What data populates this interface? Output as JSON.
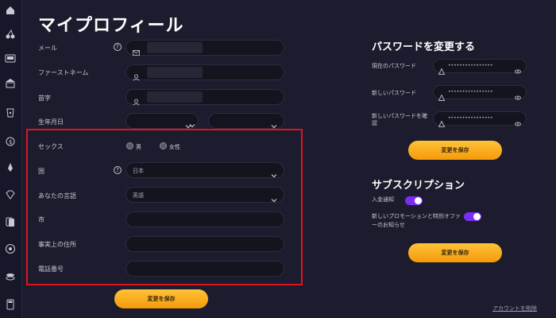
{
  "sidebar": {
    "icons": [
      "home-icon",
      "cherries-icon",
      "slot-machine-icon",
      "casino-building-icon",
      "dice-cup-icon",
      "money-bag-icon",
      "rocket-icon",
      "diamond-icon",
      "cards-icon",
      "roulette-icon",
      "chips-icon",
      "calculator-icon"
    ]
  },
  "profile": {
    "title": "マイプロフィール",
    "email_label": "メール",
    "firstname_label": "ファーストネーム",
    "lastname_label": "苗字",
    "birthdate_label": "生年月日",
    "sex_label": "セックス",
    "sex_male": "男",
    "sex_female": "女性",
    "country_label": "国",
    "country_value": "日本",
    "language_label": "あなたの言語",
    "language_value": "英語",
    "city_label": "市",
    "address_label": "事実上の住所",
    "phone_label": "電話番号",
    "help_glyph": "?",
    "save_label": "変更を保存"
  },
  "password": {
    "title": "パスワードを変更する",
    "current_label": "現在のパスワード",
    "new_label": "新しいパスワード",
    "confirm_label": "新しいパスワードを確認",
    "mask": "••••••••••••••••",
    "save_label": "変更を保存"
  },
  "subscription": {
    "title": "サブスクリプション",
    "deposit_label": "入金通知",
    "deposit_on": true,
    "promo_label": "新しいプロモーションと特別オファーのお知らせ",
    "promo_on": true,
    "save_label": "変更を保存"
  },
  "footer": {
    "delete_account": "アカウントを削除"
  },
  "colors": {
    "accent": "#f5a623",
    "toggle": "#7a2ef5",
    "highlight": "#e0141e",
    "background": "#1c1c2e"
  }
}
